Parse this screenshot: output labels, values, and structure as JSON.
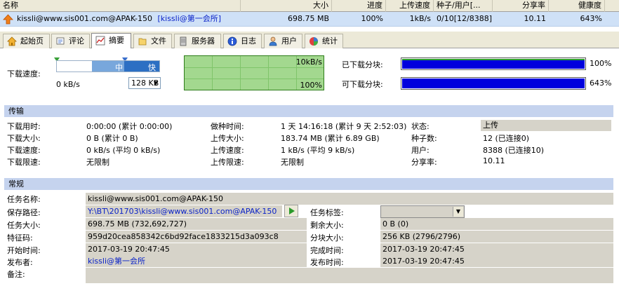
{
  "list": {
    "columns": [
      "名称",
      "大小",
      "进度",
      "上传速度",
      "种子/用户[...",
      "分享率",
      "健康度"
    ],
    "row": {
      "name": "kissli@www.sis001.com@APAK-150",
      "label": "[kissli@第一会所]",
      "size": "698.75 MB",
      "progress": "100%",
      "upload_speed": "1kB/s",
      "seeds_peers": "0/10[12/8388]",
      "ratio": "10.11",
      "health": "643%"
    }
  },
  "tabs": [
    {
      "label": "起始页",
      "icon": "home-icon"
    },
    {
      "label": "评论",
      "icon": "comment-icon"
    },
    {
      "label": "摘要",
      "icon": "chart-icon",
      "active": true
    },
    {
      "label": "文件",
      "icon": "file-icon"
    },
    {
      "label": "服务器",
      "icon": "server-icon"
    },
    {
      "label": "日志",
      "icon": "info-icon"
    },
    {
      "label": "用户",
      "icon": "user-icon"
    },
    {
      "label": "统计",
      "icon": "stats-icon"
    }
  ],
  "speed": {
    "download_label": "下载速度:",
    "slider_mid": "中",
    "slider_high": "快",
    "current": "0 kB/s",
    "limit_select": "128 KB",
    "graph_max": "10kB/s",
    "graph_pct": "100%"
  },
  "pieces": {
    "downloaded_label": "已下载分块:",
    "downloaded_pct": "100%",
    "downloaded_value": 1.0,
    "available_label": "可下载分块:",
    "available_pct": "643%",
    "available_value": 1.0
  },
  "transfer": {
    "title": "传输",
    "rows": [
      [
        [
          "下载用时:",
          "0:00:00 (累计 0:00:00)"
        ],
        [
          "做种时间:",
          "1 天 14:16:18 (累计 9 天 2:52:03)"
        ],
        [
          "状态:",
          "上传"
        ]
      ],
      [
        [
          "下载大小:",
          "0 B (累计 0 B)"
        ],
        [
          "上传大小:",
          "183.74 MB (累计 6.89 GB)"
        ],
        [
          "种子数:",
          "12 (已连接0)"
        ]
      ],
      [
        [
          "下载速度:",
          "0 kB/s (平均 0 kB/s)"
        ],
        [
          "上传速度:",
          "1 kB/s (平均 9 kB/s)"
        ],
        [
          "用户:",
          "8388 (已连接10)"
        ]
      ],
      [
        [
          "下载限速:",
          "无限制"
        ],
        [
          "上传限速:",
          "无限制"
        ],
        [
          "分享率:",
          "10.11"
        ]
      ]
    ]
  },
  "general": {
    "title": "常规",
    "task_name_label": "任务名称:",
    "task_name": "kissli@www.sis001.com@APAK-150",
    "save_path_label": "保存路径:",
    "save_path": "Y:\\BT\\201703\\kissli@www.sis001.com@APAK-150",
    "task_tag_label": "任务标签:",
    "task_tag": "",
    "task_size_label": "任务大小:",
    "task_size": "698.75 MB (732,692,727)",
    "remaining_label": "剩余大小:",
    "remaining": "0 B (0)",
    "hash_label": "特征码:",
    "hash": "959d20cea858342c6bd92face1833215d3a093c8",
    "piece_size_label": "分块大小:",
    "piece_size": "256 KB (2796/2796)",
    "start_label": "开始时间:",
    "start": "2017-03-19 20:47:45",
    "finish_label": "完成时间:",
    "finish": "2017-03-19 20:47:45",
    "publisher_label": "发布者:",
    "publisher": "kissli@第一会所",
    "publish_time_label": "发布时间:",
    "publish_time": "2017-03-19 20:47:45",
    "notes_label": "备注:",
    "notes": ""
  }
}
